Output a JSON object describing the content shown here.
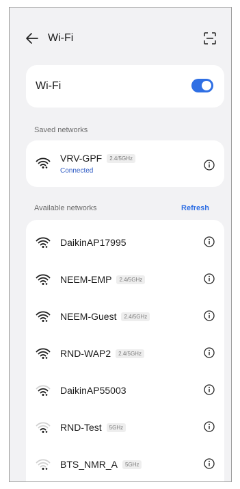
{
  "header": {
    "title": "Wi-Fi"
  },
  "wifi_toggle": {
    "label": "Wi-Fi",
    "state": "on"
  },
  "saved": {
    "section_label": "Saved networks",
    "network": {
      "name": "VRV-GPF",
      "band": "2.4/5GHz",
      "status": "Connected"
    }
  },
  "available": {
    "section_label": "Available networks",
    "refresh_label": "Refresh",
    "networks": [
      {
        "name": "DaikinAP17995",
        "band": "",
        "signal": 4
      },
      {
        "name": "NEEM-EMP",
        "band": "2.4/5GHz",
        "signal": 4
      },
      {
        "name": "NEEM-Guest",
        "band": "2.4/5GHz",
        "signal": 4
      },
      {
        "name": "RND-WAP2",
        "band": "2.4/5GHz",
        "signal": 4
      },
      {
        "name": "DaikinAP55003",
        "band": "",
        "signal": 3
      },
      {
        "name": "RND-Test",
        "band": "5GHz",
        "signal": 2
      },
      {
        "name": "BTS_NMR_A",
        "band": "5GHz",
        "signal": 1
      }
    ]
  },
  "colors": {
    "accent": "#2f6fe4",
    "background": "#f2f2f4"
  }
}
